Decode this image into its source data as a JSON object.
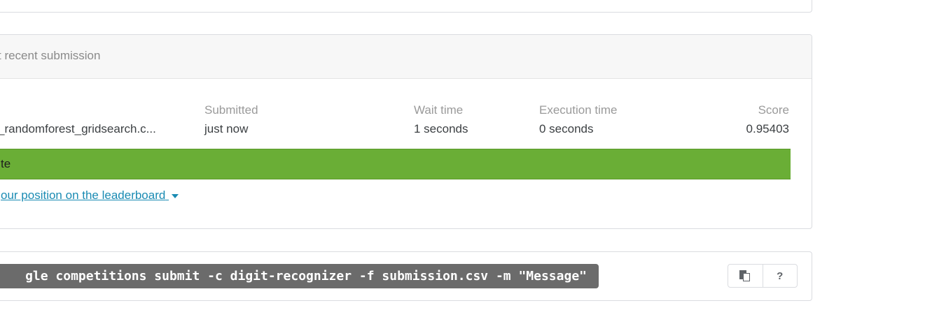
{
  "submission_card": {
    "header": "t recent submission",
    "columns": {
      "file": {
        "value": "_randomforest_gridsearch.c..."
      },
      "submitted": {
        "label": "Submitted",
        "value": "just now"
      },
      "wait_time": {
        "label": "Wait time",
        "value": "1 seconds"
      },
      "execution_time": {
        "label": "Execution time",
        "value": "0 seconds"
      },
      "score": {
        "label": "Score",
        "value": "0.95403"
      }
    },
    "status": "te",
    "leaderboard_link": "our position on the leaderboard"
  },
  "api_card": {
    "command": "gle competitions submit -c digit-recognizer -f submission.csv -m \"Message\"",
    "copy_button_icon": "copy-icon",
    "help_button_label": "?"
  },
  "colors": {
    "status_complete": "#6aae36",
    "link": "#1a8bb3",
    "code_bg": "#6b6b6b"
  }
}
